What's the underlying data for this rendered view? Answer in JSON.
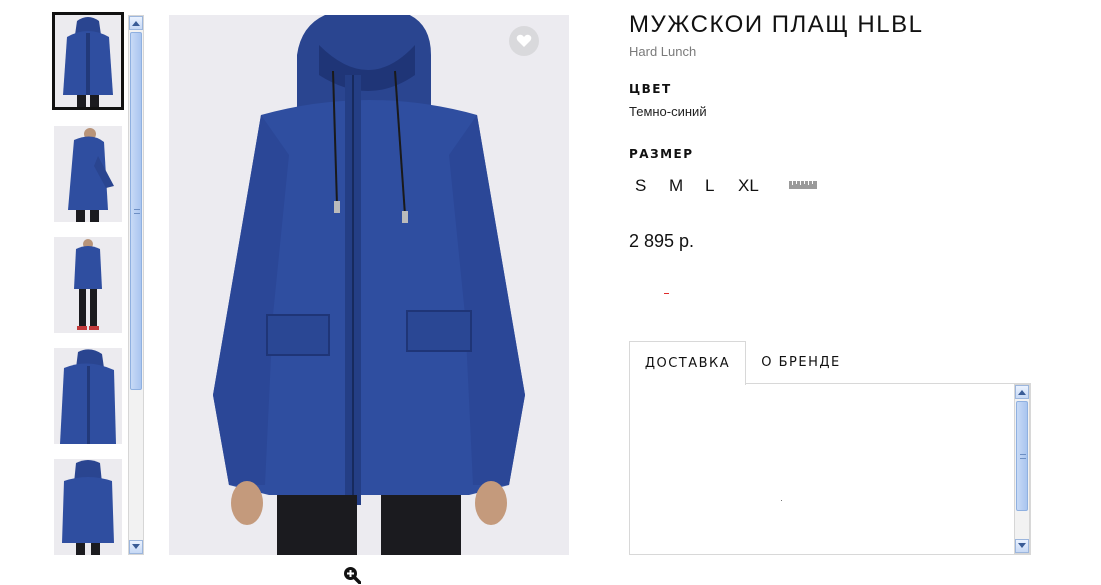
{
  "product": {
    "title": "МУЖСКОИ ПЛАЩ HLBL",
    "brand": "Hard Lunch",
    "color_label": "ЦВЕТ",
    "color_value": "Темно-синий",
    "size_label": "РАЗМЕР",
    "sizes": [
      "S",
      "M",
      "L",
      "XL"
    ],
    "price": "2 895 р.",
    "garment_color": "#2f4ea0"
  },
  "tabs": [
    {
      "label": "ДОСТАВКА",
      "active": true
    },
    {
      "label": "О БРЕНДЕ",
      "active": false
    }
  ],
  "gallery": {
    "thumbnails": [
      {
        "view": "front",
        "active": true
      },
      {
        "view": "side",
        "active": false
      },
      {
        "view": "full-body",
        "active": false
      },
      {
        "view": "three-quarter",
        "active": false
      },
      {
        "view": "back",
        "active": false
      }
    ],
    "favorite_icon": "heart-icon",
    "zoom_icon": "zoom-plus-icon"
  },
  "colors": {
    "jacket": "#2f4ea0",
    "jacket_dark": "#1f3577",
    "photo_bg": "#ecebf0",
    "scrollbar_thumb": "#a9c5ef"
  }
}
